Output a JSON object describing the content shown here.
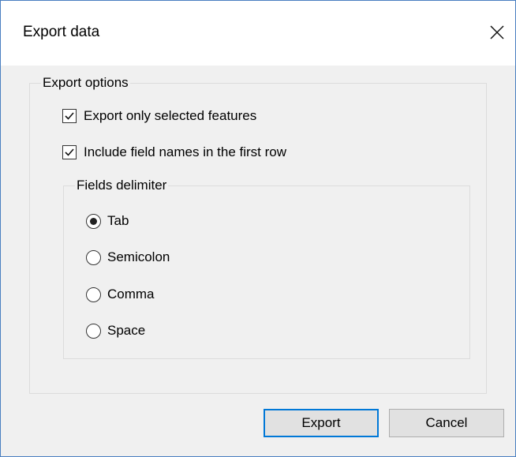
{
  "window": {
    "title": "Export data",
    "close_icon": "close-icon"
  },
  "export_options": {
    "legend": "Export options",
    "export_selected": {
      "label": "Export only selected features",
      "checked": true
    },
    "include_field_names": {
      "label": "Include field names in the first row",
      "checked": true
    }
  },
  "delimiter": {
    "legend": "Fields delimiter",
    "options": [
      {
        "label": "Tab",
        "selected": true
      },
      {
        "label": "Semicolon",
        "selected": false
      },
      {
        "label": "Comma",
        "selected": false
      },
      {
        "label": "Space",
        "selected": false
      }
    ]
  },
  "buttons": {
    "export_label": "Export",
    "cancel_label": "Cancel"
  },
  "colors": {
    "accent": "#0078d7",
    "window_border": "#4a7fc1",
    "dialog_background": "#f0f0f0"
  }
}
